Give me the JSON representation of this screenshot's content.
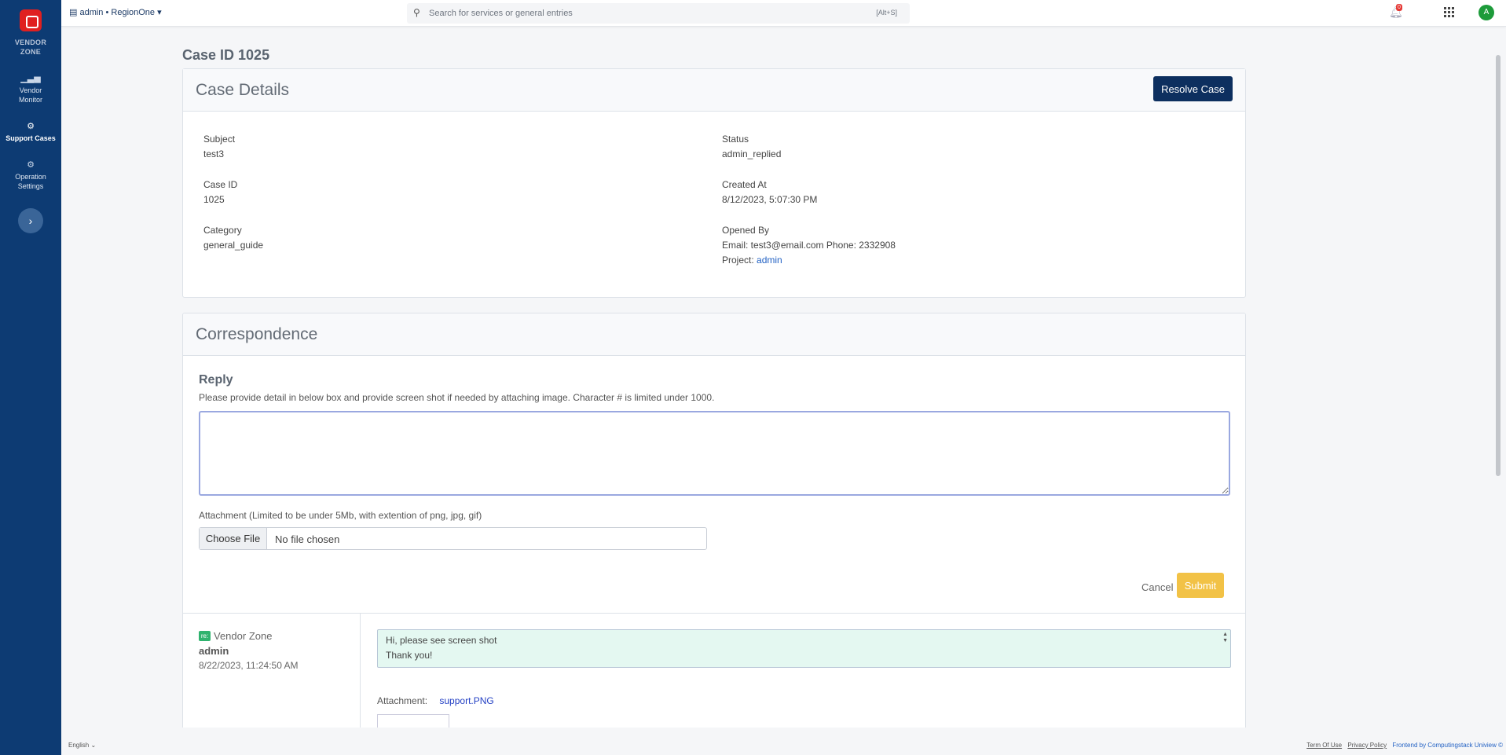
{
  "sidebar": {
    "logo_text_line1": "VENDOR",
    "logo_text_line2": "ZONE",
    "items": [
      {
        "line1": "Vendor",
        "line2": "Monitor",
        "icon": "chart-icon"
      },
      {
        "line1": "Support Cases",
        "line2": "",
        "icon": "gears-icon",
        "active": true
      },
      {
        "line1": "Operation",
        "line2": "Settings",
        "icon": "gears-icon"
      }
    ],
    "expand_icon": "›"
  },
  "topbar": {
    "scope_label": "admin • RegionOne ▾",
    "search_placeholder": "Search for services or general entries",
    "search_shortcut": "[Alt+S]",
    "notification_count": "0",
    "avatar_letter": "A"
  },
  "page": {
    "title": "Case ID 1025"
  },
  "case_details": {
    "header": "Case Details",
    "resolve_label": "Resolve Case",
    "subject_label": "Subject",
    "subject_value": "test3",
    "case_id_label": "Case ID",
    "case_id_value": "1025",
    "category_label": "Category",
    "category_value": "general_guide",
    "status_label": "Status",
    "status_value": "admin_replied",
    "created_label": "Created At",
    "created_value": "8/12/2023, 5:07:30 PM",
    "opened_label": "Opened By",
    "opened_contact": "Email: test3@email.com Phone: 2332908",
    "project_label": "Project:",
    "project_value": "admin"
  },
  "correspondence": {
    "header": "Correspondence",
    "reply_title": "Reply",
    "reply_hint": "Please provide detail in below box and provide screen shot if needed by attaching image. Character # is limited under 1000.",
    "reply_value": "",
    "attachment_hint": "Attachment (Limited to be under 5Mb, with extention of png, jpg, gif)",
    "choose_file_label": "Choose File",
    "file_status": "No file chosen",
    "cancel_label": "Cancel",
    "submit_label": "Submit",
    "thread": [
      {
        "badge": "re:",
        "sender": "Vendor Zone",
        "user": "admin",
        "time": "8/22/2023, 11:24:50 AM",
        "message_line1": "Hi, please see screen shot",
        "message_line2": "Thank you!",
        "attachment_label": "Attachment:",
        "attachment_file": "support.PNG"
      }
    ]
  },
  "footer": {
    "language": "English",
    "terms": "Term Of Use",
    "privacy": "Privacy Policy",
    "brand": "Frontend by Computingstack Uniview ©"
  },
  "colors": {
    "sidebar_bg": "#0d3b73",
    "primary_button": "#0d2f5f",
    "submit_button": "#f2c246",
    "message_bg": "#e4f8f1",
    "link": "#2362c4"
  }
}
